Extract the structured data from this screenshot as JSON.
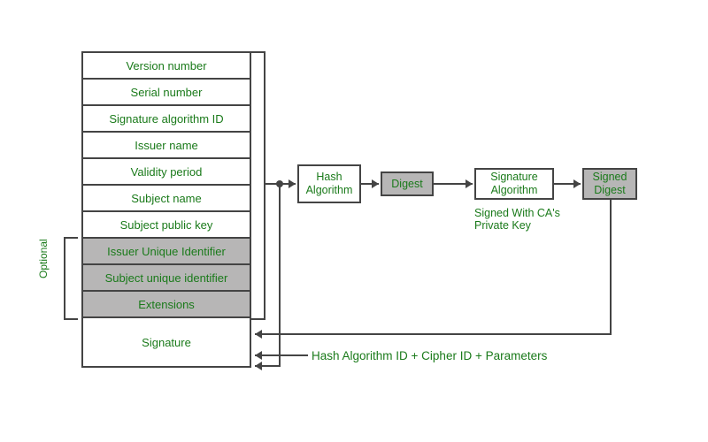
{
  "cert_fields": {
    "version": "Version number",
    "serial": "Serial number",
    "sig_alg_id": "Signature algorithm ID",
    "issuer": "Issuer name",
    "validity": "Validity period",
    "subject": "Subject name",
    "subject_pubkey": "Subject public key",
    "issuer_uid": "Issuer Unique Identifier",
    "subject_uid": "Subject unique identifier",
    "extensions": "Extensions",
    "signature": "Signature"
  },
  "optional_label": "Optional",
  "nodes": {
    "hash_alg": "Hash\nAlgorithm",
    "digest": "Digest",
    "sig_alg": "Signature\nAlgorithm",
    "signed_digest": "Signed\nDigest"
  },
  "captions": {
    "signed_with": "Signed With CA's\nPrivate Key"
  },
  "footer_label": "Hash Algorithm ID + Cipher ID + Parameters"
}
